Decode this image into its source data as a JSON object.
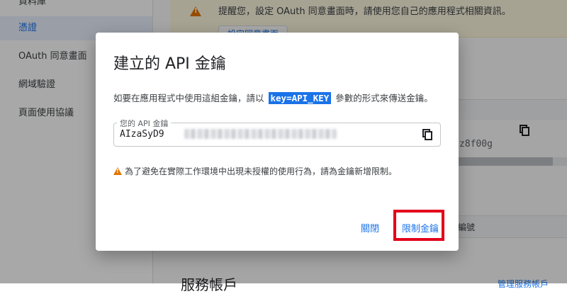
{
  "sidebar": {
    "items": [
      {
        "label": "資料庫"
      },
      {
        "label": "憑證"
      },
      {
        "label": "OAuth 同意畫面"
      },
      {
        "label": "網域驗證"
      },
      {
        "label": "頁面使用協議"
      }
    ]
  },
  "background": {
    "warning_text": "提醒您，設定 OAuth 同意畫面時，請使用您自己的應用程式相關資訊。",
    "consent_button": "設定同意畫面",
    "key_suffix": "z8f00g",
    "row_text": "編號",
    "heading": "服務帳戶",
    "link_text": "管理服務帳戶"
  },
  "dialog": {
    "title": "建立的 API 金鑰",
    "desc_before": "如要在應用程式中使用這組金鑰，請以",
    "desc_code": "key=API_KEY",
    "desc_after": "參數的形式來傳送金鑰。",
    "field_label": "您的 API 金鑰",
    "key_prefix": "AIzaSyD9",
    "warning": "為了避免在實際工作環境中出現未授權的使用行為，請為金鑰新增限制。",
    "close_label": "關閉",
    "restrict_label": "限制金鑰"
  },
  "colors": {
    "accent": "#1a73e8",
    "warning": "#e37400",
    "highlight": "#e3001b"
  }
}
